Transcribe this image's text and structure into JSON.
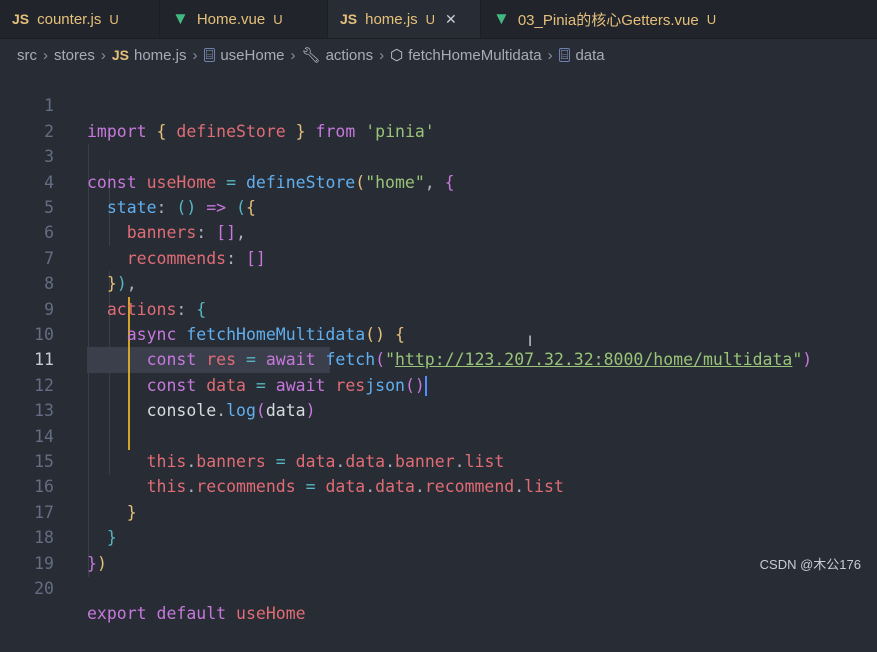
{
  "tabs": [
    {
      "icon": "JS",
      "name": "counter.js",
      "status": "U"
    },
    {
      "icon": "vue-icon",
      "name": "Home.vue",
      "status": "U"
    },
    {
      "icon": "JS",
      "name": "home.js",
      "status": "U",
      "close": "✕"
    },
    {
      "icon": "vue-icon",
      "name": "03_Pinia的核心Getters.vue",
      "status": "U"
    }
  ],
  "breadcrumb": {
    "src": "src",
    "stores": "stores",
    "file_icon": "JS",
    "file": "home.js",
    "sym1": "useHome",
    "sym2": "actions",
    "sym3": "fetchHomeMultidata",
    "sym4": "data"
  },
  "line_numbers": [
    "1",
    "2",
    "3",
    "4",
    "5",
    "6",
    "7",
    "8",
    "9",
    "10",
    "11",
    "12",
    "13",
    "14",
    "15",
    "16",
    "17",
    "18",
    "19",
    "20"
  ],
  "current_line": "11",
  "code": {
    "l1": {
      "a": "import",
      "b": "{",
      "c": "defineStore",
      "d": "}",
      "e": "from",
      "f": "'pinia'"
    },
    "l3": {
      "a": "const",
      "b": "useHome",
      "c": "=",
      "d": "defineStore",
      "e": "(",
      "f": "\"home\"",
      "g": ",",
      "h": "{"
    },
    "l4": {
      "a": "state",
      "b": ":",
      "c": "()",
      "d": "=>",
      "e": "(",
      "f": "{"
    },
    "l5": {
      "a": "banners",
      "b": ":",
      "c": "[]",
      "d": ","
    },
    "l6": {
      "a": "recommends",
      "b": ":",
      "c": "[]"
    },
    "l7": {
      "a": "}",
      "b": ")",
      "c": ","
    },
    "l8": {
      "a": "actions",
      "b": ":",
      "c": "{"
    },
    "l9": {
      "a": "async",
      "b": "fetchHomeMultidata",
      "c": "()",
      "d": "{"
    },
    "l10": {
      "a": "const",
      "b": "res",
      "c": "=",
      "d": "await",
      "e": "fetch",
      "f": "(",
      "g": "\"",
      "h": "http://123.207.32.32:8000/home/multidata",
      "i": "\"",
      "j": ")"
    },
    "l11": {
      "a": "const",
      "b": "data",
      "c": "=",
      "d": "await",
      "e": "res",
      ".": ".",
      "f": "json",
      "g": "()"
    },
    "l12": {
      "a": "console",
      "b": ".",
      "c": "log",
      "d": "(",
      "e": "data",
      "f": ")"
    },
    "l14": {
      "a": "this",
      "b": ".",
      "c": "banners",
      "d": "=",
      "e": "data",
      "f": ".",
      "g": "data",
      "h": ".",
      "i": "banner",
      "j": ".",
      "k": "list"
    },
    "l15": {
      "a": "this",
      "b": ".",
      "c": "recommends",
      "d": "=",
      "e": "data",
      "f": ".",
      "g": "data",
      "h": ".",
      "i": "recommend",
      "j": ".",
      "k": "list"
    },
    "l16": {
      "a": "}"
    },
    "l17": {
      "a": "}"
    },
    "l18": {
      "a": "}",
      "b": ")"
    },
    "l20": {
      "a": "export",
      "b": "default",
      "c": "useHome"
    }
  },
  "watermark": "CSDN @木公176",
  "colors": {
    "keyword": "#c678dd",
    "function": "#61afef",
    "variable": "#e06c75",
    "string": "#98c379",
    "modified": "#e5c07b"
  }
}
